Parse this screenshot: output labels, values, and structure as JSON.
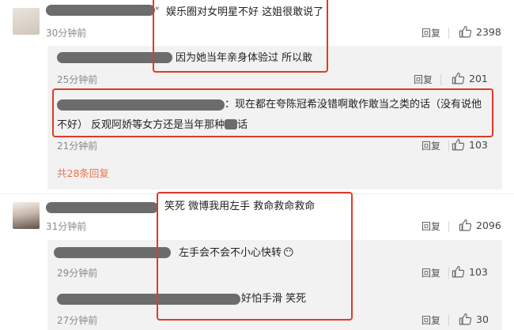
{
  "comment1": {
    "text": "娱乐圈对女明星不好 这姐很敢说了",
    "time": "30分钟前",
    "reply_label": "回复",
    "likes": "2398",
    "replies": [
      {
        "text": "因为她当年亲身体验过 所以敢",
        "time": "25分钟前",
        "reply_label": "回复",
        "likes": "201"
      },
      {
        "text_line1": "：现在都在夸陈冠希没错啊敢作敢当之类的话（没有说他",
        "text_line2": "不好） 反观阿娇等女方还是当年那种",
        "text_line2_tail": "话",
        "time": "21分钟前",
        "reply_label": "回复",
        "likes": "103"
      }
    ],
    "more_link": "共28条回复"
  },
  "comment2": {
    "text": "笑死 微博我用左手 救命救命救命",
    "time": "31分钟前",
    "reply_label": "回复",
    "likes": "2096",
    "replies": [
      {
        "text": "左手会不会不小心快转",
        "emoji": "😶",
        "time": "29分钟前",
        "reply_label": "回复",
        "likes": "103"
      },
      {
        "text": "好怕手滑 笑死",
        "time": "27分钟前",
        "reply_label": "回复",
        "likes": "30"
      }
    ]
  },
  "colors": {
    "highlight_border": "#e03a26",
    "link": "#eb7350",
    "redaction": "#6c6c6c",
    "reply_bg": "#f2f2f2"
  },
  "icons": {
    "like": "thumbs-up-icon"
  }
}
